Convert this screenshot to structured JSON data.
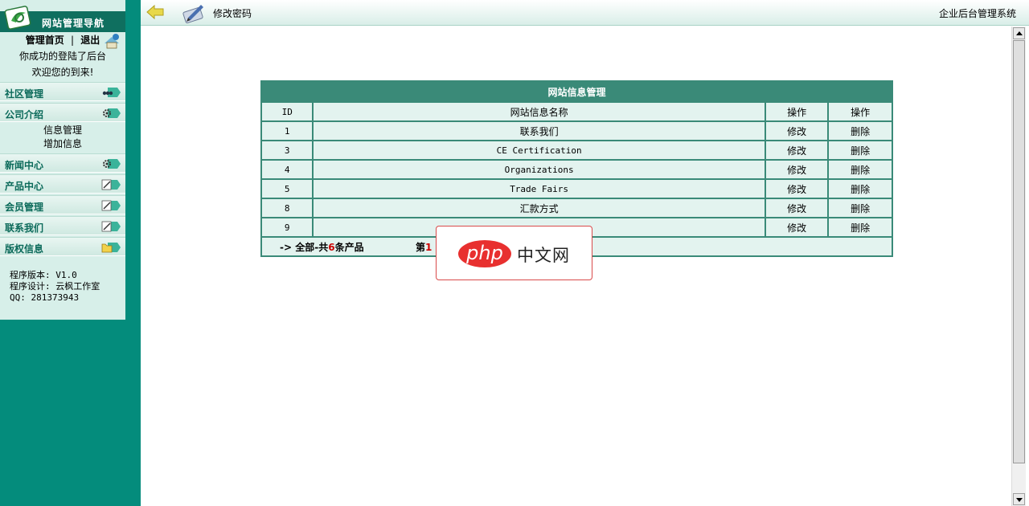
{
  "sidebar": {
    "title": "网站管理导航",
    "home_link": "管理首页",
    "separator": "|",
    "logout_link": "退出",
    "welcome_line1": "你成功的登陆了后台",
    "welcome_line2": "欢迎您的到来!",
    "menu": [
      {
        "label": "社区管理",
        "icon": "community-icon"
      },
      {
        "label": "公司介绍",
        "icon": "gear-icon"
      },
      {
        "label": "新闻中心",
        "icon": "gear-icon"
      },
      {
        "label": "产品中心",
        "icon": "edit-icon"
      },
      {
        "label": "会员管理",
        "icon": "edit-icon"
      },
      {
        "label": "联系我们",
        "icon": "edit-icon"
      },
      {
        "label": "版权信息",
        "icon": "folder-icon"
      }
    ],
    "company_sub": [
      "信息管理",
      "增加信息"
    ],
    "footer": {
      "version": "程序版本: V1.0",
      "designer": "程序设计: 云枫工作室",
      "qq": "QQ: 281373943"
    }
  },
  "topbar": {
    "change_password": "修改密码",
    "system_title": "企业后台管理系统"
  },
  "table": {
    "caption": "网站信息管理",
    "headers": [
      "ID",
      "网站信息名称",
      "操作",
      "操作"
    ],
    "rows": [
      {
        "id": "1",
        "name": "联系我们",
        "edit": "修改",
        "delete": "删除"
      },
      {
        "id": "3",
        "name": "CE Certification",
        "edit": "修改",
        "delete": "删除"
      },
      {
        "id": "4",
        "name": "Organizations",
        "edit": "修改",
        "delete": "删除"
      },
      {
        "id": "5",
        "name": "Trade Fairs",
        "edit": "修改",
        "delete": "删除"
      },
      {
        "id": "8",
        "name": "汇款方式",
        "edit": "修改",
        "delete": "删除"
      },
      {
        "id": "9",
        "name": "",
        "edit": "修改",
        "delete": "删除"
      }
    ],
    "footer": {
      "prefix": "-> 全部-共",
      "count": "6",
      "suffix": "条产品",
      "page_prefix": "第",
      "page_num": "1"
    }
  },
  "watermark": {
    "logo_text": "php",
    "site_text": "中文网"
  },
  "colors": {
    "sidebar_bg": "#048c7c",
    "nav_bg": "#d7efe9",
    "table_header": "#3a8a78",
    "highlight": "#cc0000"
  }
}
